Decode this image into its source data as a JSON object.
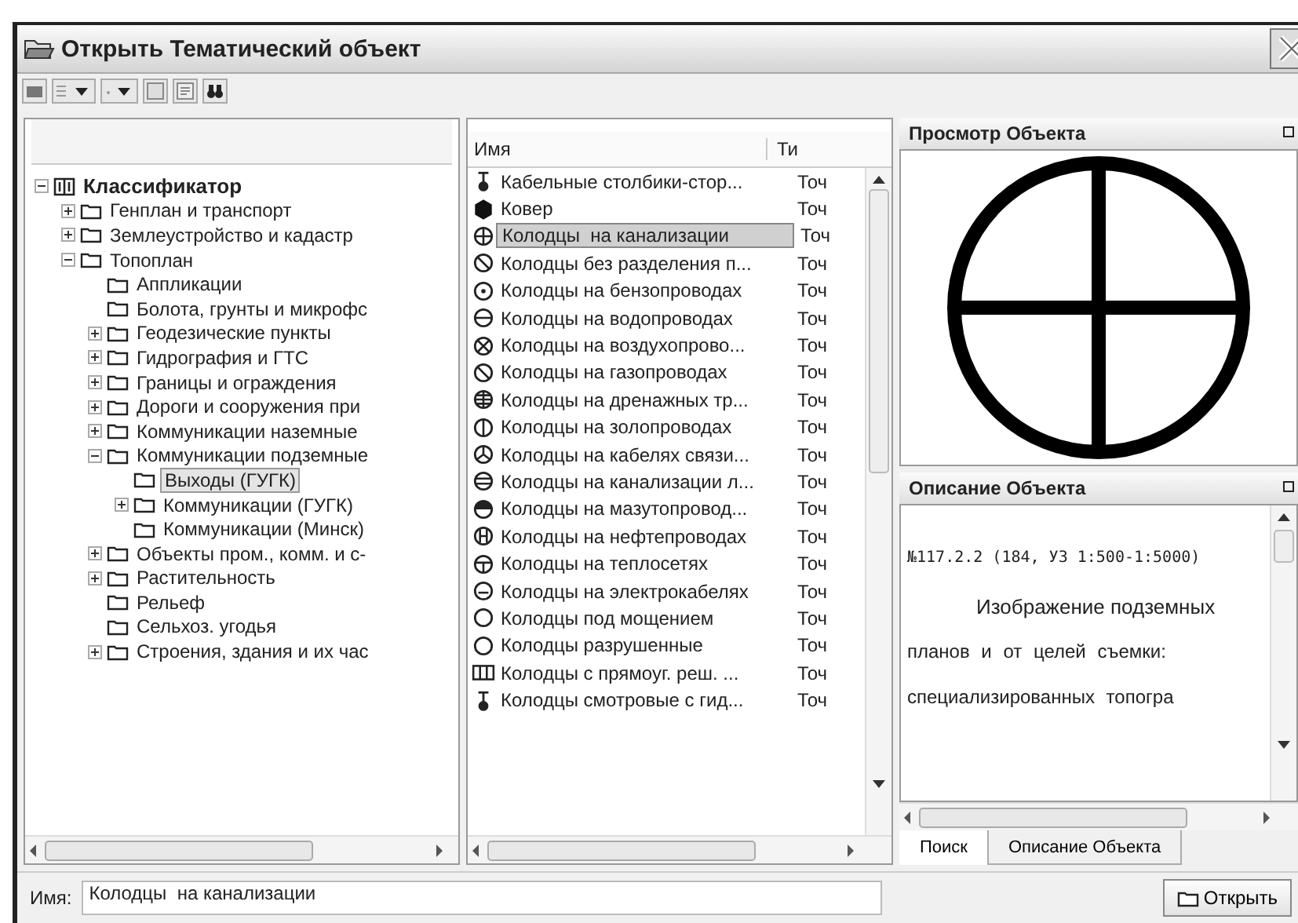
{
  "window": {
    "title": "Открыть Тематический объект"
  },
  "tree": [
    {
      "label": "Классификатор",
      "kind": "root",
      "expanded": true,
      "selected": false,
      "children": [
        {
          "label": "Генплан и транспорт",
          "expanded": false,
          "selected": false
        },
        {
          "label": "Землеустройство и кадастр",
          "expanded": false,
          "selected": false
        },
        {
          "label": "Топоплан",
          "expanded": true,
          "selected": false,
          "children": [
            {
              "label": "Аппликации",
              "selected": false
            },
            {
              "label": "Болота, грунты и микрофс",
              "selected": false
            },
            {
              "label": "Геодезические пункты",
              "expanded": false,
              "selected": false
            },
            {
              "label": "Гидрография и ГТС",
              "expanded": false,
              "selected": false
            },
            {
              "label": "Границы и ограждения",
              "expanded": false,
              "selected": false
            },
            {
              "label": "Дороги и сооружения при",
              "expanded": false,
              "selected": false
            },
            {
              "label": "Коммуникации наземные",
              "expanded": false,
              "selected": false
            },
            {
              "label": "Коммуникации подземные",
              "expanded": true,
              "selected": false,
              "children": [
                {
                  "label": "Выходы (ГУГК)",
                  "selected": true
                },
                {
                  "label": "Коммуникации (ГУГК)",
                  "expanded": false,
                  "selected": false
                },
                {
                  "label": "Коммуникации (Минск)",
                  "selected": false
                }
              ]
            },
            {
              "label": "Объекты пром., комм. и с-",
              "expanded": false,
              "selected": false
            },
            {
              "label": "Растительность",
              "expanded": false,
              "selected": false
            },
            {
              "label": "Рельеф",
              "selected": false
            },
            {
              "label": "Сельхоз. угодья",
              "selected": false
            },
            {
              "label": "Строения, здания и их час",
              "expanded": false,
              "selected": false
            }
          ]
        }
      ]
    }
  ],
  "list": {
    "columns": [
      "Имя",
      "Ти"
    ],
    "rows": [
      {
        "name": "Кабельные столбики-стор...",
        "type": "Точ",
        "kind": "post",
        "selected": false
      },
      {
        "name": "Ковер",
        "type": "Точ",
        "kind": "hexagon",
        "selected": false
      },
      {
        "name": "Колодцы  на канализации",
        "type": "Точ",
        "kind": "cross",
        "selected": true
      },
      {
        "name": "Колодцы без разделения п...",
        "type": "Точ",
        "kind": "slash",
        "selected": false
      },
      {
        "name": "Колодцы на бензопроводах",
        "type": "Точ",
        "kind": "dot",
        "selected": false
      },
      {
        "name": "Колодцы на водопроводах",
        "type": "Точ",
        "kind": "hline",
        "selected": false
      },
      {
        "name": "Колодцы на воздухопрово...",
        "type": "Точ",
        "kind": "x",
        "selected": false
      },
      {
        "name": "Колодцы на газопроводах",
        "type": "Точ",
        "kind": "slash",
        "selected": false
      },
      {
        "name": "Колодцы на дренажных тр...",
        "type": "Точ",
        "kind": "grid",
        "selected": false
      },
      {
        "name": "Колодцы на золопроводах",
        "type": "Точ",
        "kind": "vline",
        "selected": false
      },
      {
        "name": "Колодцы на кабелях связи...",
        "type": "Точ",
        "kind": "y",
        "selected": false
      },
      {
        "name": "Колодцы на канализации л...",
        "type": "Точ",
        "kind": "hlines",
        "selected": false
      },
      {
        "name": "Колодцы на мазутопровод...",
        "type": "Точ",
        "kind": "half",
        "selected": false
      },
      {
        "name": "Колодцы на нефтепроводах",
        "type": "Точ",
        "kind": "h",
        "selected": false
      },
      {
        "name": "Колодцы на теплосетях",
        "type": "Точ",
        "kind": "t",
        "selected": false
      },
      {
        "name": "Колодцы на электрокабелях",
        "type": "Точ",
        "kind": "dash",
        "selected": false
      },
      {
        "name": "Колодцы под мощением",
        "type": "Точ",
        "kind": "ring",
        "selected": false
      },
      {
        "name": "Колодцы разрушенные",
        "type": "Точ",
        "kind": "ring",
        "selected": false
      },
      {
        "name": "Колодцы с прямоуг. реш. ...",
        "type": "Точ",
        "kind": "rect",
        "selected": false
      },
      {
        "name": "Колодцы смотровые с гид...",
        "type": "Точ",
        "kind": "post",
        "selected": false
      }
    ]
  },
  "preview": {
    "title": "Просмотр Объекта"
  },
  "description": {
    "title": "Описание Объекта",
    "lines": [
      {
        "text": "№117.2.2 (184, УЗ 1:500-1:5000)",
        "kind": "code"
      },
      {
        "text": "Изображение подземных",
        "kind": "indent"
      },
      {
        "text": "планов и от целей съемки:",
        "kind": "plain"
      },
      {
        "text": "специализированных топогра",
        "kind": "plain"
      }
    ]
  },
  "tabs": [
    {
      "label": "Поиск",
      "selected": true
    },
    {
      "label": "Описание Объекта",
      "selected": false
    }
  ],
  "bottom": {
    "label": "Имя:",
    "value": "Колодцы  на канализации",
    "button": "Открыть"
  }
}
